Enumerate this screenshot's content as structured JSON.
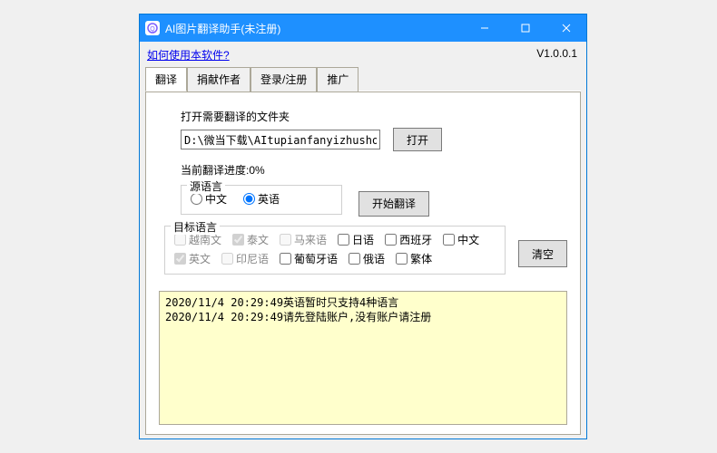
{
  "window": {
    "title": "AI图片翻译助手(未注册)"
  },
  "help_link": "如何使用本软件?",
  "version": "V1.0.0.1",
  "tabs": {
    "t0": "翻译",
    "t1": "捐献作者",
    "t2": "登录/注册",
    "t3": "推广"
  },
  "folder": {
    "label": "打开需要翻译的文件夹",
    "value": "D:\\微当下载\\AItupianfanyizhushou",
    "open_btn": "打开"
  },
  "progress_text": "当前翻译进度:0%",
  "source_group": {
    "legend": "源语言",
    "zh": "中文",
    "en": "英语"
  },
  "start_btn": "开始翻译",
  "target_group": {
    "legend": "目标语言",
    "vi": "越南文",
    "th": "泰文",
    "ms": "马来语",
    "ja": "日语",
    "es": "西班牙",
    "zh": "中文",
    "en": "英文",
    "id": "印尼语",
    "pt": "葡萄牙语",
    "ru": "俄语",
    "zt": "繁体"
  },
  "clear_btn": "清空",
  "log": {
    "l0": "2020/11/4 20:29:49英语暂时只支持4种语言",
    "l1": "2020/11/4 20:29:49请先登陆账户,没有账户请注册"
  }
}
